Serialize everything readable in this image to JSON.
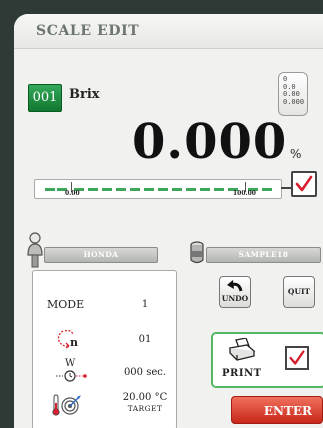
{
  "header": {
    "title": "SCALE EDIT"
  },
  "scale": {
    "number": "001",
    "name": "Brix",
    "value": "0.000",
    "unit": "%",
    "format_options": [
      "0",
      "0.0",
      "0.00",
      "0.000"
    ]
  },
  "range": {
    "min_label": "0.00",
    "max_label": "100.00",
    "enabled": true
  },
  "user": {
    "label": "HONDA"
  },
  "sample": {
    "label": "SAMPLE18"
  },
  "settings": {
    "mode_label": "MODE",
    "mode_value": "1",
    "repeat_value": "01",
    "wait_value": "000 sec.",
    "wait_icon_letter": "W",
    "temp_value": "20.00 °C",
    "temp_caption": "TARGET"
  },
  "buttons": {
    "undo": "UNDO",
    "quit": "QUIT",
    "print": "PRINT",
    "enter": "ENTER"
  },
  "print": {
    "enabled": true
  },
  "colors": {
    "accent_green": "#11782f",
    "enter_red": "#c8271a",
    "bar_green": "#3ea65a"
  }
}
